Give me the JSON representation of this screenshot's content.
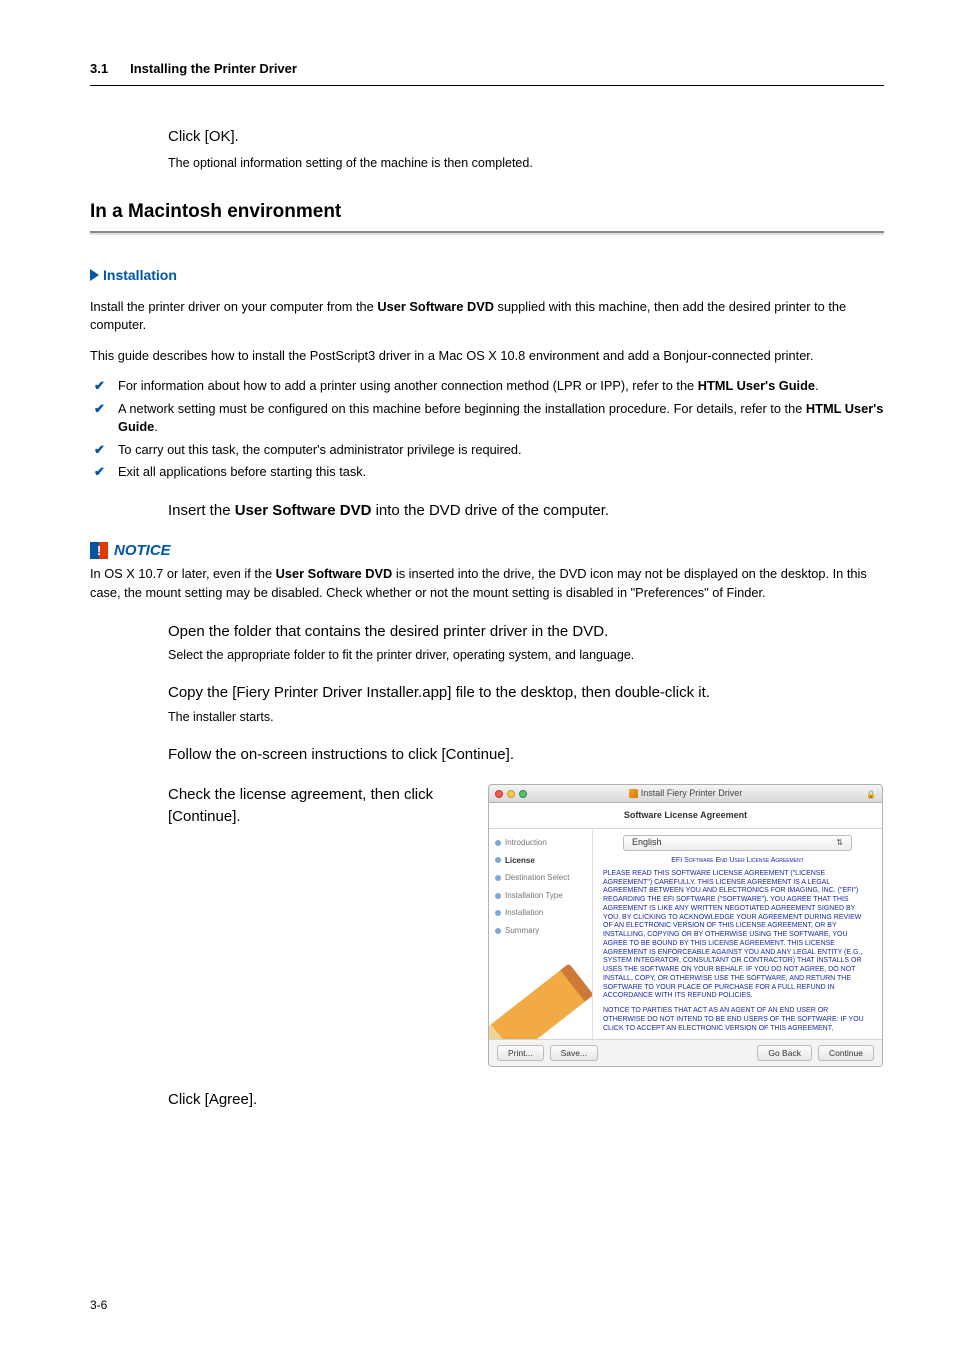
{
  "header": {
    "number": "3.1",
    "title": "Installing the Printer Driver"
  },
  "intro_step": {
    "main": "Click [OK].",
    "sub": "The optional information setting of the machine is then completed."
  },
  "section_title": "In a Macintosh environment",
  "subsection": "Installation",
  "para1_a": "Install the printer driver on your computer from the ",
  "para1_b": "User Software DVD",
  "para1_c": " supplied with this machine, then add the desired printer to the computer.",
  "para2": "This guide describes how to install the PostScript3 driver in a Mac OS X 10.8 environment and add a Bonjour-connected printer.",
  "bullets": [
    {
      "pre": "For information about how to add a printer using another connection method (LPR or IPP), refer to the ",
      "bold": "HTML User's Guide",
      "post": "."
    },
    {
      "pre": "A network setting must be configured on this machine before beginning the installation procedure. For details, refer to the ",
      "bold": "HTML User's Guide",
      "post": "."
    },
    {
      "pre": "To carry out this task, the computer's administrator privilege is required.",
      "bold": "",
      "post": ""
    },
    {
      "pre": "Exit all applications before starting this task.",
      "bold": "",
      "post": ""
    }
  ],
  "step_insert_a": "Insert the ",
  "step_insert_b": "User Software DVD",
  "step_insert_c": " into the DVD drive of the computer.",
  "notice_label": "NOTICE",
  "notice_a": "In OS X 10.7 or later, even if the ",
  "notice_b": "User Software DVD",
  "notice_c": " is inserted into the drive, the DVD icon may not be displayed on the desktop. In this case, the mount setting may be disabled. Check whether or not the mount setting is disabled in \"Preferences\" of Finder.",
  "step_open_main": "Open the folder that contains the desired printer driver in the DVD.",
  "step_open_sub": "Select the appropriate folder to fit the printer driver, operating system, and language.",
  "step_copy_main": "Copy the [Fiery Printer Driver Installer.app] file to the desktop, then double-click it.",
  "step_copy_sub": "The installer starts.",
  "step_follow": "Follow the on-screen instructions to click [Continue].",
  "step_license": "Check the license agreement, then click [Continue].",
  "installer": {
    "window_title": "Install Fiery Printer Driver",
    "subtitle": "Software License Agreement",
    "language": "English",
    "side_steps": [
      "Introduction",
      "License",
      "Destination Select",
      "Installation Type",
      "Installation",
      "Summary"
    ],
    "efi_header": "EFI Software End User License Agreement",
    "lic1": "PLEASE READ THIS SOFTWARE LICENSE AGREEMENT (\"LICENSE AGREEMENT\") CAREFULLY. THIS LICENSE AGREEMENT IS A LEGAL AGREEMENT BETWEEN YOU AND ELECTRONICS FOR IMAGING, INC. (\"EFI\") REGARDING THE EFI SOFTWARE (\"SOFTWARE\"). YOU AGREE THAT THIS AGREEMENT IS LIKE ANY WRITTEN NEGOTIATED AGREEMENT SIGNED BY YOU. BY CLICKING TO ACKNOWLEDGE YOUR AGREEMENT DURING REVIEW OF AN ELECTRONIC VERSION OF THIS LICENSE AGREEMENT, OR BY INSTALLING, COPYING OR BY OTHERWISE USING THE SOFTWARE, YOU AGREE TO BE BOUND BY THIS LICENSE AGREEMENT. THIS LICENSE AGREEMENT IS ENFORCEABLE AGAINST YOU AND ANY LEGAL ENTITY (E.G., SYSTEM INTEGRATOR, CONSULTANT OR CONTRACTOR) THAT INSTALLS OR USES THE SOFTWARE ON YOUR BEHALF. IF YOU DO NOT AGREE, DO NOT INSTALL, COPY, OR OTHERWISE USE THE SOFTWARE, AND RETURN THE SOFTWARE TO YOUR PLACE OF PURCHASE FOR A FULL REFUND IN ACCORDANCE WITH ITS REFUND POLICIES.",
    "lic2": "NOTICE TO PARTIES THAT ACT AS AN AGENT OF AN END USER OR OTHERWISE DO NOT INTEND TO BE END USERS OF THE SOFTWARE: IF YOU CLICK TO ACCEPT AN ELECTRONIC VERSION OF THIS AGREEMENT,",
    "buttons": {
      "print": "Print...",
      "save": "Save...",
      "goback": "Go Back",
      "continue": "Continue"
    }
  },
  "step_agree": "Click [Agree].",
  "page_number": "3-6"
}
